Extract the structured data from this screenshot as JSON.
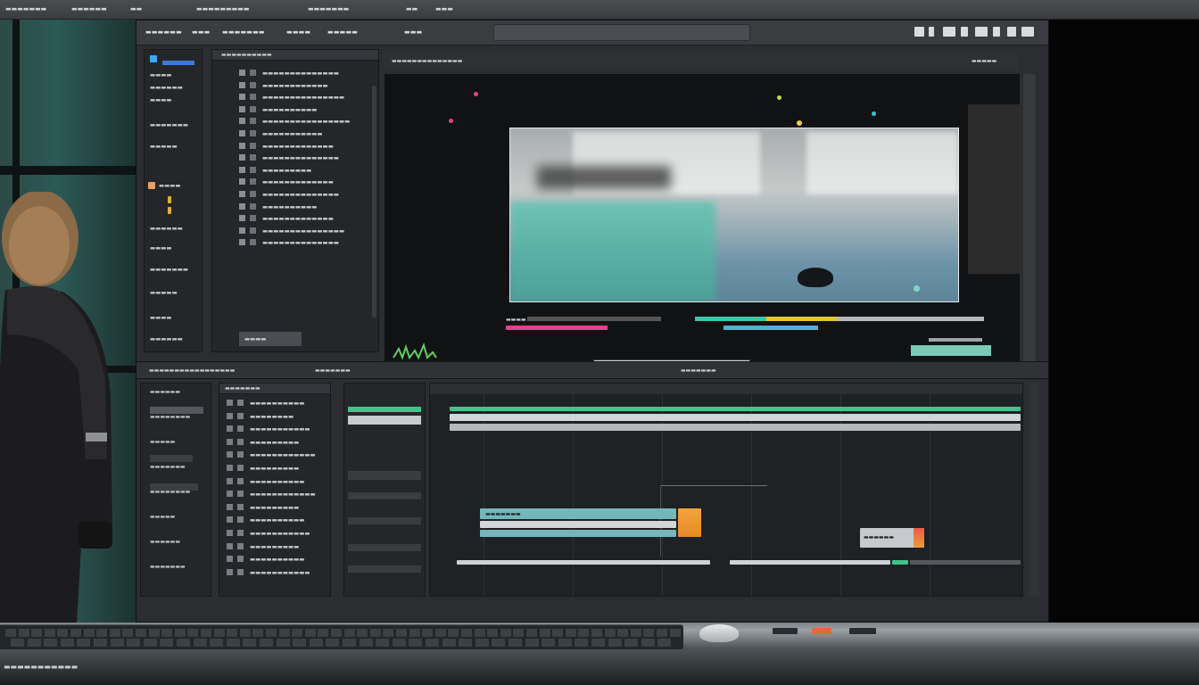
{
  "os_bar": {
    "items": [
      "▬▬▬▬▬▬▬",
      "▬▬▬▬▬▬",
      "▬▬",
      "▬▬▬▬▬▬▬▬▬",
      "▬▬▬▬▬▬▬",
      "▬▬",
      "▬▬▬"
    ]
  },
  "toolbar": {
    "groups": [
      "▬▬▬▬▬▬",
      "▬▬▬",
      "▬▬▬▬▬▬▬",
      "▬▬▬▬",
      "▬▬▬▬▬",
      "▬▬▬"
    ],
    "search_placeholder": ""
  },
  "sidebar": {
    "items": [
      "▬▬▬▬",
      "▬▬▬▬▬▬",
      "▬▬▬▬",
      "▬▬▬▬▬▬▬",
      "▬▬▬▬▬",
      "▬▬▬▬",
      "▬▬▬▬▬▬",
      "▬▬▬▬",
      "▬▬▬▬▬▬▬",
      "▬▬▬▬▬",
      "▬▬▬▬",
      "▬▬▬▬▬▬"
    ]
  },
  "browser": {
    "header": "▬▬▬▬▬▬▬▬▬▬",
    "rows": [
      "▬▬▬▬▬▬▬▬▬▬▬▬▬▬",
      "▬▬▬▬▬▬▬▬▬▬▬▬",
      "▬▬▬▬▬▬▬▬▬▬▬▬▬▬▬",
      "▬▬▬▬▬▬▬▬▬▬",
      "▬▬▬▬▬▬▬▬▬▬▬▬▬▬▬▬",
      "▬▬▬▬▬▬▬▬▬▬▬",
      "▬▬▬▬▬▬▬▬▬▬▬▬▬",
      "▬▬▬▬▬▬▬▬▬▬▬▬▬▬",
      "▬▬▬▬▬▬▬▬▬",
      "▬▬▬▬▬▬▬▬▬▬▬▬▬",
      "▬▬▬▬▬▬▬▬▬▬▬▬▬▬",
      "▬▬▬▬▬▬▬▬▬▬",
      "▬▬▬▬▬▬▬▬▬▬▬▬▬",
      "▬▬▬▬▬▬▬▬▬▬▬▬▬▬▬",
      "▬▬▬▬▬▬▬▬▬▬▬▬▬▬"
    ],
    "footer": "▬▬▬▬"
  },
  "viewer": {
    "header_left": "▬▬▬▬▬▬▬▬▬▬▬▬▬▬",
    "header_right": "▬▬▬▬▬",
    "timecode": "▬▬▬▬"
  },
  "timeline": {
    "ruler": "▬▬▬▬▬▬▬▬▬▬▬▬▬▬▬▬▬",
    "tracks_header": "▬▬▬▬▬▬▬",
    "track_names": [
      "▬▬▬▬▬▬▬▬▬▬",
      "▬▬▬▬▬▬▬▬",
      "▬▬▬▬▬▬▬▬▬▬▬",
      "▬▬▬▬▬▬▬▬▬",
      "▬▬▬▬▬▬▬▬▬▬▬▬",
      "▬▬▬▬▬▬▬▬▬",
      "▬▬▬▬▬▬▬▬▬▬",
      "▬▬▬▬▬▬▬▬▬▬▬▬",
      "▬▬▬▬▬▬▬▬▬",
      "▬▬▬▬▬▬▬▬▬▬",
      "▬▬▬▬▬▬▬▬▬▬▬",
      "▬▬▬▬▬▬▬▬▬",
      "▬▬▬▬▬▬▬▬▬▬",
      "▬▬▬▬▬▬▬▬▬▬▬"
    ],
    "clip_a_label": "▬▬▬▬▬▬▬",
    "clip_b_label": "▬▬▬▬▬▬"
  },
  "inspector": {
    "items": [
      "▬▬▬▬▬▬",
      "▬▬▬▬▬▬▬▬",
      "▬▬▬▬▬",
      "▬▬▬▬▬▬▬",
      "▬▬▬▬▬▬▬▬",
      "▬▬▬▬▬",
      "▬▬▬▬▬▬",
      "▬▬▬▬▬▬▬"
    ]
  },
  "desk": {
    "label": "▬▬▬▬▬▬▬▬▬▬▬"
  },
  "colors": {
    "accent_green": "#3fc48d",
    "accent_blue": "#3a7bd5",
    "accent_pink": "#e0458a",
    "accent_orange": "#f0962e",
    "clip_teal": "#73b7ba"
  }
}
